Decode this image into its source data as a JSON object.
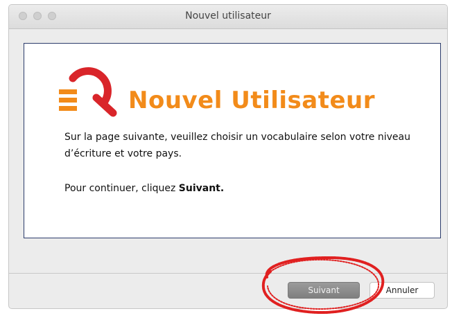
{
  "window": {
    "title": "Nouvel utilisateur"
  },
  "content": {
    "heading": "Nouvel Utilisateur",
    "paragraph1": "Sur la page suivante, veuillez choisir un vocabulaire selon votre niveau d’écriture et votre pays.",
    "paragraph2_prefix": "Pour continuer, cliquez ",
    "paragraph2_bold": "Suivant."
  },
  "buttons": {
    "next_label": "Suivant",
    "cancel_label": "Annuler"
  },
  "colors": {
    "heading": "#f28b1a",
    "logo_red": "#d9252a",
    "logo_orange": "#f28b1a",
    "annotation": "#e02020"
  },
  "icons": {
    "logo": "antidote-logo-icon"
  }
}
